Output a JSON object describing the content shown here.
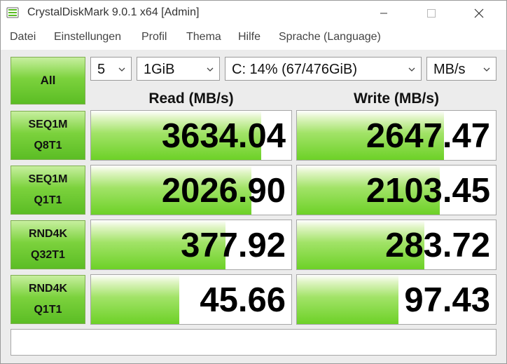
{
  "window": {
    "title": "CrystalDiskMark 9.0.1 x64 [Admin]"
  },
  "menu": [
    "Datei",
    "Einstellungen",
    "Profil",
    "Thema",
    "Hilfe",
    "Sprache (Language)"
  ],
  "controls": {
    "all_label": "All",
    "count": "5",
    "size": "1GiB",
    "drive": "C: 14% (67/476GiB)",
    "unit": "MB/s"
  },
  "headers": {
    "read": "Read (MB/s)",
    "write": "Write (MB/s)"
  },
  "tests": [
    {
      "line1": "SEQ1M",
      "line2": "Q8T1",
      "read": "3634.04",
      "write": "2647.47",
      "read_fill": 0.85,
      "write_fill": 0.74
    },
    {
      "line1": "SEQ1M",
      "line2": "Q1T1",
      "read": "2026.90",
      "write": "2103.45",
      "read_fill": 0.8,
      "write_fill": 0.72
    },
    {
      "line1": "RND4K",
      "line2": "Q32T1",
      "read": "377.92",
      "write": "283.72",
      "read_fill": 0.67,
      "write_fill": 0.64
    },
    {
      "line1": "RND4K",
      "line2": "Q1T1",
      "read": "45.66",
      "write": "97.43",
      "read_fill": 0.44,
      "write_fill": 0.51
    }
  ],
  "comment": "",
  "colors": {
    "accent_green": "#6dd127",
    "label_green": "#7cd23d"
  },
  "icons": {
    "app": "crystaldiskmark-app-icon",
    "minimize": "minimize-icon",
    "maximize": "maximize-icon",
    "close": "close-icon",
    "dropdown": "chevron-down-icon"
  }
}
